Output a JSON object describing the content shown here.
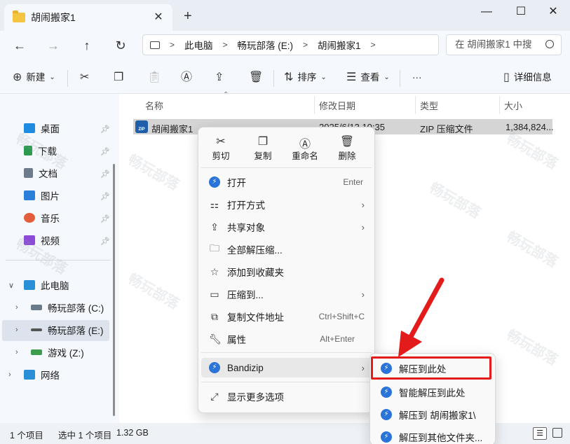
{
  "window": {
    "tab_title": "胡闹搬家1",
    "tab_close": "✕",
    "tab_add": "+",
    "min": "—",
    "max": "☐",
    "close": "✕"
  },
  "nav": {
    "back": "←",
    "forward": "→",
    "up": "↑",
    "refresh": "↻",
    "breadcrumb": [
      "此电脑",
      "畅玩部落 (E:)",
      "胡闹搬家1"
    ],
    "sep": ">",
    "search_placeholder": "在 胡闹搬家1 中搜"
  },
  "toolbar": {
    "new_label": "新建",
    "sort_label": "排序",
    "view_label": "查看",
    "more": "···",
    "details_label": "详细信息"
  },
  "sidebar": {
    "quick": [
      {
        "label": "桌面",
        "color": "#1e8ae0"
      },
      {
        "label": "下载",
        "color": "#2b9a4f"
      },
      {
        "label": "文档",
        "color": "#6d7b8a"
      },
      {
        "label": "图片",
        "color": "#2a7fd9"
      },
      {
        "label": "音乐",
        "color": "#e25d3b"
      },
      {
        "label": "视频",
        "color": "#8b4bd6"
      }
    ],
    "pc_label": "此电脑",
    "drives": [
      {
        "label": "畅玩部落 (C:)"
      },
      {
        "label": "畅玩部落 (E:)"
      },
      {
        "label": "游戏 (Z:)"
      }
    ],
    "network_label": "网络"
  },
  "columns": {
    "name": "名称",
    "date": "修改日期",
    "type": "类型",
    "size": "大小"
  },
  "file": {
    "icon_text": "ZIP",
    "name": "胡闹搬家1",
    "date": "2025/6/13 10:35",
    "type": "ZIP 压缩文件",
    "size": "1,384,824..."
  },
  "status": {
    "count": "1 个项目",
    "selected": "选中 1 个项目",
    "size": "1.32 GB"
  },
  "context_menu": {
    "quick_actions": [
      "剪切",
      "复制",
      "重命名",
      "删除"
    ],
    "items": [
      {
        "label": "打开",
        "shortcut": "Enter"
      },
      {
        "label": "打开方式",
        "shortcut": ""
      },
      {
        "label": "共享对象",
        "shortcut": ""
      },
      {
        "label": "全部解压缩...",
        "shortcut": ""
      },
      {
        "label": "添加到收藏夹",
        "shortcut": ""
      },
      {
        "label": "压缩到...",
        "shortcut": ""
      },
      {
        "label": "复制文件地址",
        "shortcut": "Ctrl+Shift+C"
      },
      {
        "label": "属性",
        "shortcut": "Alt+Enter"
      }
    ],
    "bandizip_label": "Bandizip",
    "more_label": "显示更多选项",
    "arrow": "›"
  },
  "submenu": {
    "items": [
      "解压到此处",
      "智能解压到此处",
      "解压到 胡闹搬家1\\",
      "解压到其他文件夹..."
    ]
  },
  "watermark": "畅玩部落",
  "colors": {
    "highlight": "#e31b1b",
    "accent": "#2a73d9"
  }
}
